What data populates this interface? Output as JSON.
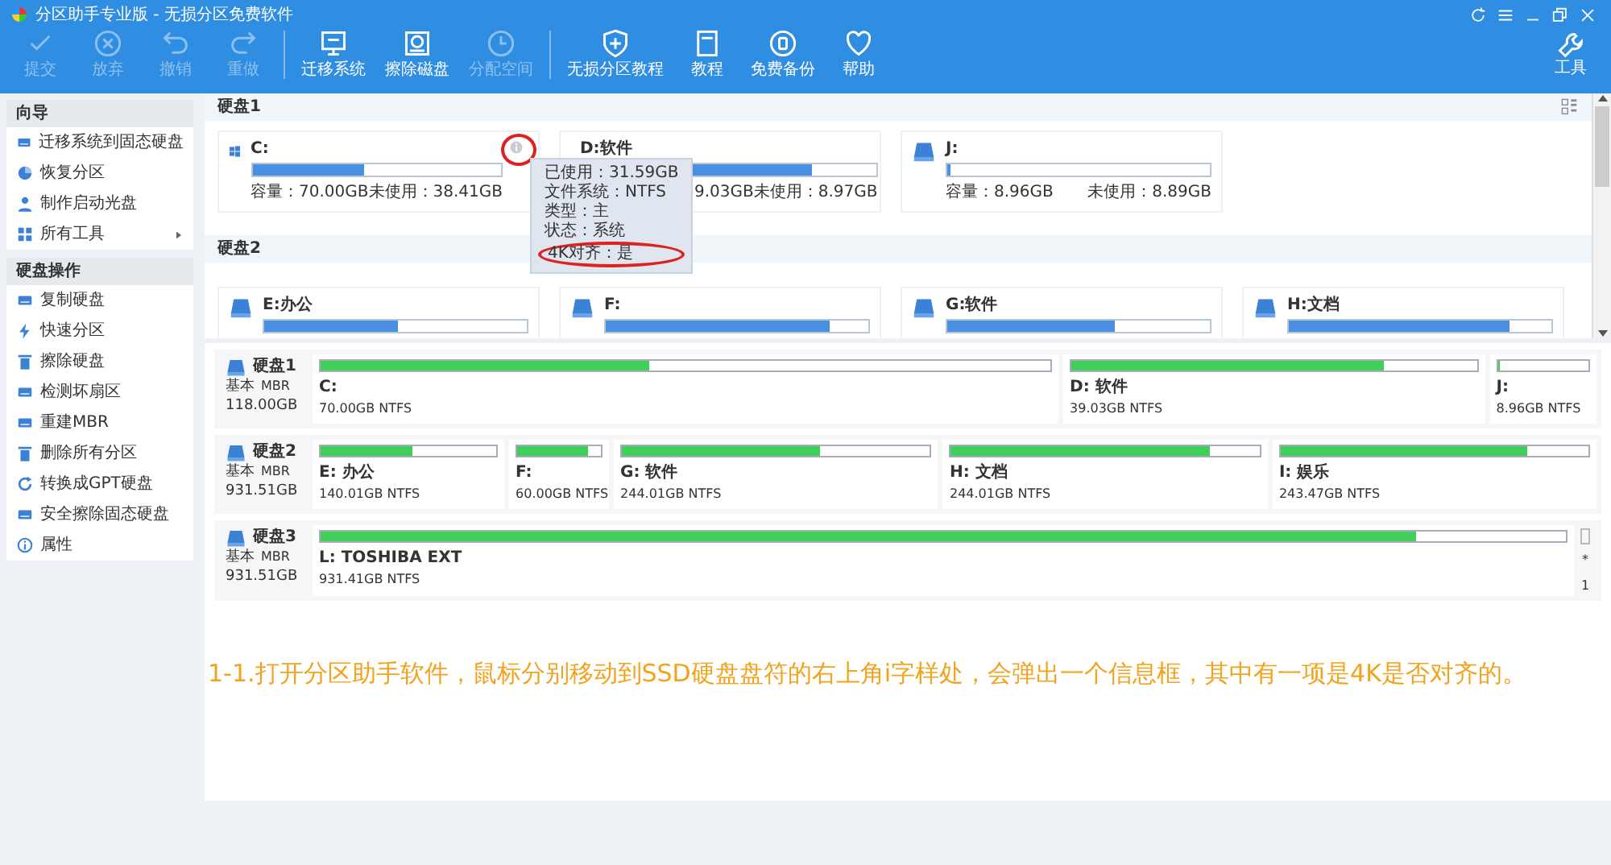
{
  "window": {
    "title": "分区助手专业版 - 无损分区免费软件"
  },
  "toolbar": [
    {
      "label": "提交",
      "disabled": true
    },
    {
      "label": "放弃",
      "disabled": true
    },
    {
      "label": "撤销",
      "disabled": true
    },
    {
      "label": "重做",
      "disabled": true
    },
    {
      "label": "迁移系统",
      "disabled": false
    },
    {
      "label": "擦除磁盘",
      "disabled": false
    },
    {
      "label": "分配空间",
      "disabled": true
    },
    {
      "label": "无损分区教程",
      "disabled": false
    },
    {
      "label": "教程",
      "disabled": false
    },
    {
      "label": "免费备份",
      "disabled": false
    },
    {
      "label": "帮助",
      "disabled": false
    }
  ],
  "tools_button": {
    "label": "工具"
  },
  "sidebar": {
    "sections": [
      {
        "title": "向导",
        "items": [
          {
            "label": "迁移系统到固态硬盘",
            "submenu": false
          },
          {
            "label": "恢复分区",
            "submenu": false
          },
          {
            "label": "制作启动光盘",
            "submenu": false
          },
          {
            "label": "所有工具",
            "submenu": true
          }
        ]
      },
      {
        "title": "硬盘操作",
        "items": [
          {
            "label": "复制硬盘",
            "submenu": false
          },
          {
            "label": "快速分区",
            "submenu": false
          },
          {
            "label": "擦除硬盘",
            "submenu": false
          },
          {
            "label": "检测坏扇区",
            "submenu": false
          },
          {
            "label": "重建MBR",
            "submenu": false
          },
          {
            "label": "删除所有分区",
            "submenu": false
          },
          {
            "label": "转换成GPT硬盘",
            "submenu": false
          },
          {
            "label": "安全擦除固态硬盘",
            "submenu": false
          },
          {
            "label": "属性",
            "submenu": false
          }
        ]
      }
    ]
  },
  "cards": {
    "disks": [
      {
        "title": "硬盘1",
        "partitions": [
          {
            "name": "C:",
            "kind": "system",
            "level": 0.45,
            "capacity": "容量：70.00GB",
            "free": "未使用：38.41GB",
            "info_icon": true,
            "circled": true
          },
          {
            "name": "D:软件",
            "kind": "data",
            "level": 0.78,
            "capacity": "9.03GB",
            "free": "未使用：8.97GB",
            "info_icon": false,
            "circled": false
          },
          {
            "name": "J:",
            "kind": "data",
            "level": 0.01,
            "capacity": "容量：8.96GB",
            "free": "未使用：8.89GB",
            "info_icon": false,
            "circled": false
          }
        ]
      },
      {
        "title": "硬盘2",
        "partitions": [
          {
            "name": "E:办公",
            "kind": "data",
            "level": 0.51
          },
          {
            "name": "F:",
            "kind": "data",
            "level": 0.85
          },
          {
            "name": "G:软件",
            "kind": "data",
            "level": 0.64
          },
          {
            "name": "H:文档",
            "kind": "data",
            "level": 0.84
          }
        ]
      }
    ],
    "popup": {
      "rows": [
        {
          "text": "已使用：31.59GB",
          "circled": false
        },
        {
          "text": "文件系统：NTFS",
          "circled": false
        },
        {
          "text": "类型：主",
          "circled": false
        },
        {
          "text": "状态：系统",
          "circled": false
        },
        {
          "text": "4K对齐：是",
          "circled": true
        }
      ]
    }
  },
  "disk_map": [
    {
      "name": "硬盘1",
      "type": "基本",
      "style": "MBR",
      "size": "118.00GB",
      "partitions": [
        {
          "name": "C:",
          "info": "70.00GB NTFS",
          "level": 0.45
        },
        {
          "name": "D: 软件",
          "info": "39.03GB NTFS",
          "level": 0.77
        },
        {
          "name": "J:",
          "info": "8.96GB NTFS",
          "level": 0.01
        }
      ]
    },
    {
      "name": "硬盘2",
      "type": "基本",
      "style": "MBR",
      "size": "931.51GB",
      "partitions": [
        {
          "name": "E: 办公",
          "info": "140.01GB NTFS",
          "level": 0.52
        },
        {
          "name": "F:",
          "info": "60.00GB NTFS",
          "level": 0.85
        },
        {
          "name": "G: 软件",
          "info": "244.01GB NTFS",
          "level": 0.64
        },
        {
          "name": "H: 文档",
          "info": "244.01GB NTFS",
          "level": 0.84
        },
        {
          "name": "I: 娱乐",
          "info": "243.47GB NTFS",
          "level": 0.8
        }
      ]
    },
    {
      "name": "硬盘3",
      "type": "基本",
      "style": "MBR",
      "size": "931.51GB",
      "partitions": [
        {
          "name": "L: TOSHIBA EXT",
          "info": "931.41GB NTFS",
          "level": 0.88
        }
      ],
      "side_marks": [
        "*",
        "1"
      ]
    }
  ],
  "caption": "1-1.打开分区助手软件，鼠标分别移动到SSD硬盘盘符的右上角i字样处，会弹出一个信息框，其中有一项是4K是否对齐的。"
}
